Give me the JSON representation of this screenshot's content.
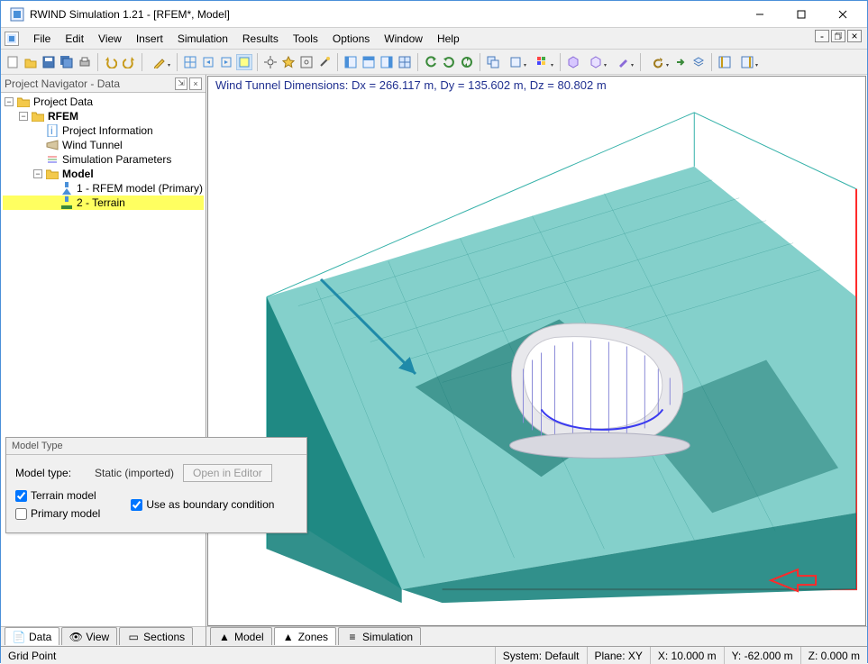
{
  "title": "RWIND Simulation 1.21 - [RFEM*, Model]",
  "menu": [
    "File",
    "Edit",
    "View",
    "Insert",
    "Simulation",
    "Results",
    "Tools",
    "Options",
    "Window",
    "Help"
  ],
  "navigator_title": "Project Navigator - Data",
  "tree": {
    "root": "Project Data",
    "rfem": "RFEM",
    "proj_info": "Project Information",
    "wind_tunnel": "Wind Tunnel",
    "sim_params": "Simulation Parameters",
    "model": "Model",
    "rfem_model": "1 - RFEM model (Primary)",
    "terrain": "2 - Terrain"
  },
  "overlay": "Wind Tunnel Dimensions: Dx = 266.117 m, Dy = 135.602 m, Dz = 80.802 m",
  "model_type_panel": {
    "title": "Model Type",
    "label": "Model type:",
    "value": "Static (imported)",
    "open_btn": "Open in Editor",
    "terrain_chk": "Terrain model",
    "boundary_chk": "Use as boundary condition",
    "primary_chk": "Primary model"
  },
  "sidebar_tabs": {
    "data": "Data",
    "view": "View",
    "sections": "Sections"
  },
  "view_tabs": {
    "model": "Model",
    "zones": "Zones",
    "simulation": "Simulation"
  },
  "status": {
    "left": "Grid Point",
    "system": "System: Default",
    "plane": "Plane: XY",
    "x": "X: 10.000 m",
    "y": "Y:  -62.000 m",
    "z": "Z:  0.000 m"
  },
  "colors": {
    "teal": "#1fa9a0",
    "teal_light": "#8fd5cf",
    "red": "#ff2a2a"
  }
}
